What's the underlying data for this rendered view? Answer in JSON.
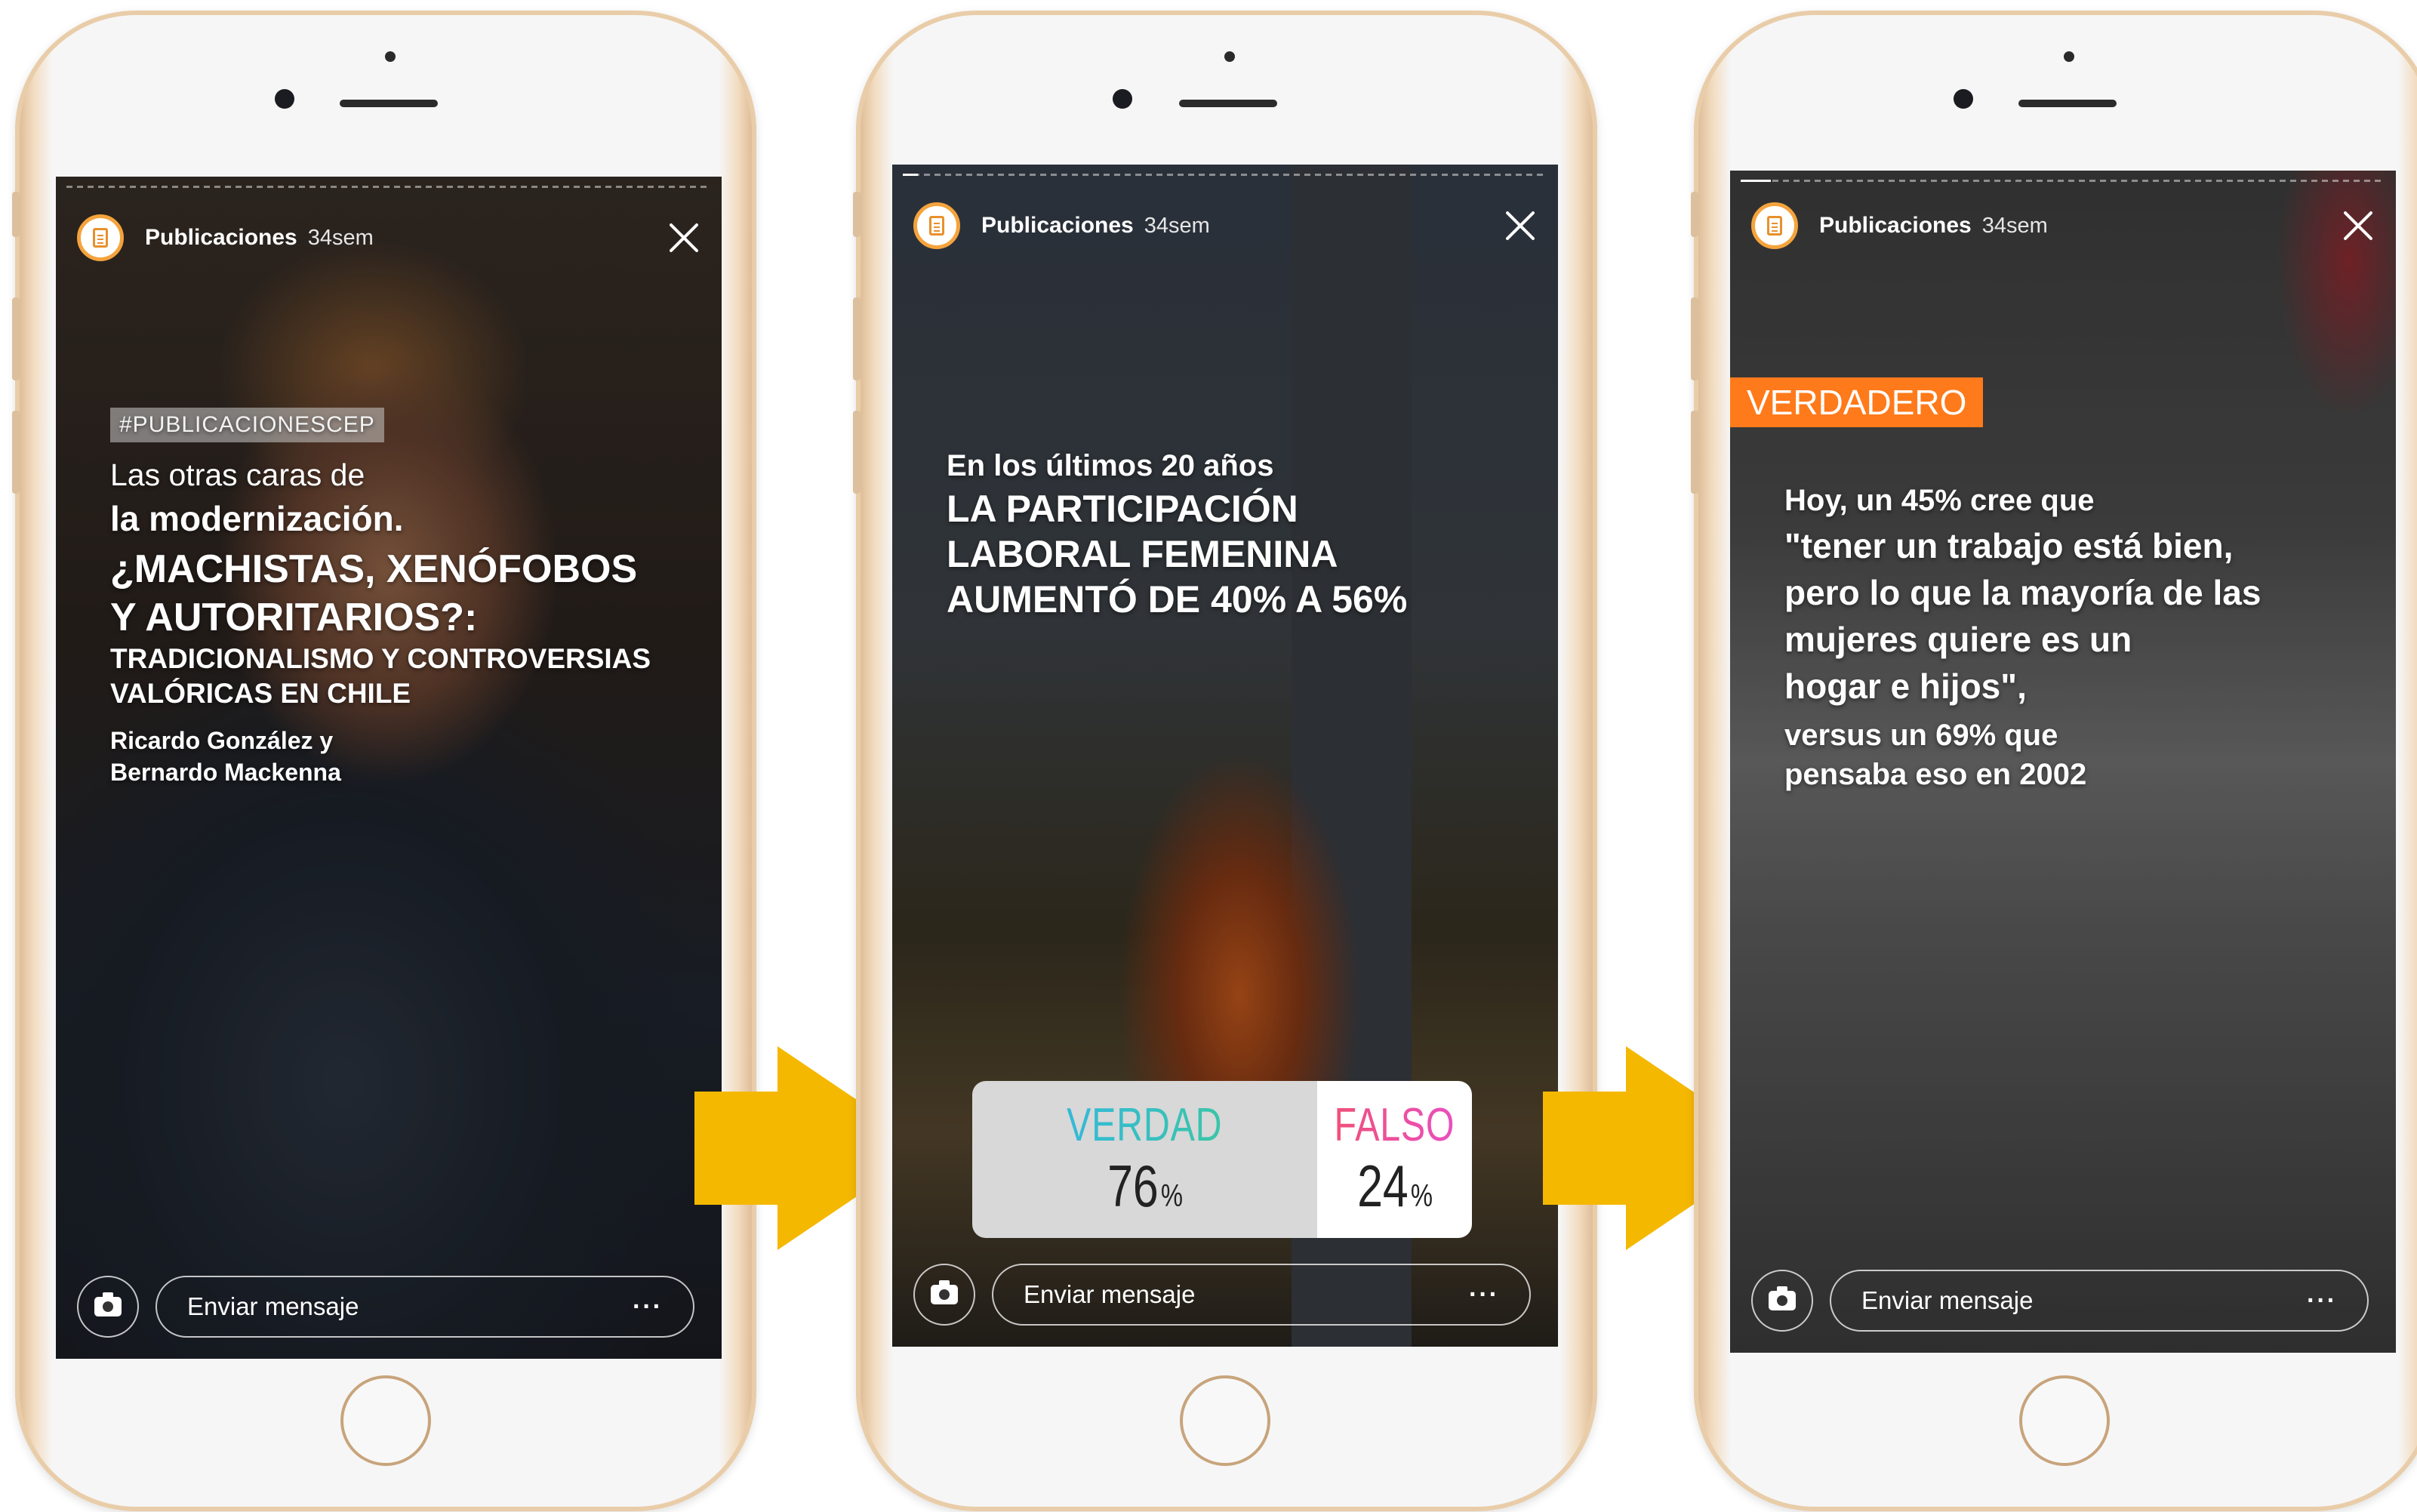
{
  "common": {
    "account_name": "Publicaciones",
    "time_ago": "34sem",
    "message_placeholder": "Enviar mensaje",
    "more_label": "···"
  },
  "story1": {
    "hashtag": "#PUBLICACIONESCEP",
    "line1": "Las otras caras de",
    "line2": "la modernización.",
    "headline1": "¿MACHISTAS, XENÓFOBOS",
    "headline2": "Y AUTORITARIOS?:",
    "sub1": "TRADICIONALISMO Y CONTROVERSIAS",
    "sub2": "VALÓRICAS EN CHILE",
    "author1": "Ricardo González y",
    "author2": "Bernardo Mackenna"
  },
  "story2": {
    "intro": "En los últimos 20 años",
    "headline1": "LA PARTICIPACIÓN",
    "headline2": "LABORAL FEMENINA",
    "headline3": "AUMENTÓ DE 40% A 56%",
    "poll": {
      "option_a": "VERDAD",
      "option_a_value": "76",
      "option_b": "FALSO",
      "option_b_value": "24",
      "unit": "%"
    }
  },
  "story3": {
    "tag": "VERDADERO",
    "line1": "Hoy, un 45% cree que",
    "line2": "\"tener un trabajo está bien,",
    "line3": "pero lo que la mayoría de las",
    "line4": "mujeres quiere es un",
    "line5": "hogar e hijos\",",
    "line6": "versus un 69% que",
    "line7": "pensaba eso en 2002"
  },
  "colors": {
    "avatar_ring": "#f4a33c",
    "arrow": "#f5b800",
    "tag_true": "#ff7a1a",
    "verdad_gradient": [
      "#34b9d9",
      "#3bc5a8"
    ],
    "falso_gradient": [
      "#f0507a",
      "#e94fbf"
    ]
  },
  "icons": [
    "publicaciones-avatar-icon",
    "close-icon",
    "camera-icon",
    "more-icon",
    "arrow-right-icon"
  ]
}
